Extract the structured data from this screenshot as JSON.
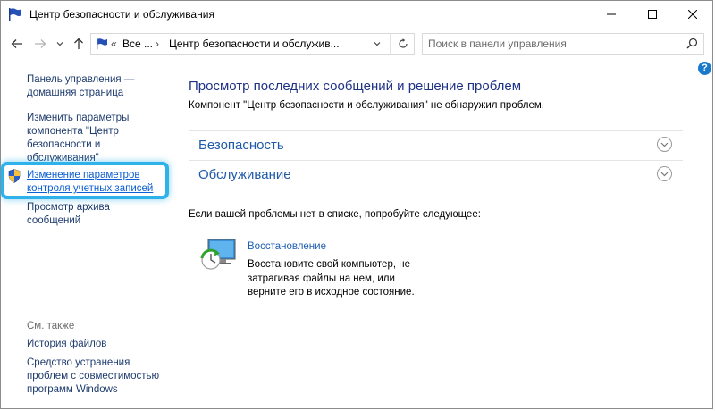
{
  "window": {
    "title": "Центр безопасности и обслуживания"
  },
  "address_bar": {
    "overflow": "«",
    "crumbs": [
      "Все ...",
      "Центр безопасности и обслужив..."
    ]
  },
  "search": {
    "placeholder": "Поиск в панели управления"
  },
  "sidebar": {
    "home_link": "Панель управления — домашняя страница",
    "change_settings_link": "Изменить параметры компонента \"Центр безопасности и обслуживания\"",
    "uac_link": "Изменение параметров контроля учетных записей",
    "archive_link": "Просмотр архива сообщений",
    "see_also_label": "См. также",
    "file_history_link": "История файлов",
    "compat_link": "Средство устранения проблем с совместимостью программ Windows"
  },
  "main": {
    "title": "Просмотр последних сообщений и решение проблем",
    "description": "Компонент \"Центр безопасности и обслуживания\" не обнаружил проблем.",
    "sections": [
      {
        "label": "Безопасность"
      },
      {
        "label": "Обслуживание"
      }
    ],
    "try_text": "Если вашей проблемы нет в списке, попробуйте следующее:",
    "recovery": {
      "title": "Восстановление",
      "description": "Восстановите свой компьютер, не затрагивая файлы на нем, или верните его в исходное состояние."
    }
  },
  "colors": {
    "highlight": "#2fb2ea",
    "link": "#1f3c6e",
    "heading": "#1e3287",
    "help_badge": "#1979ca"
  }
}
